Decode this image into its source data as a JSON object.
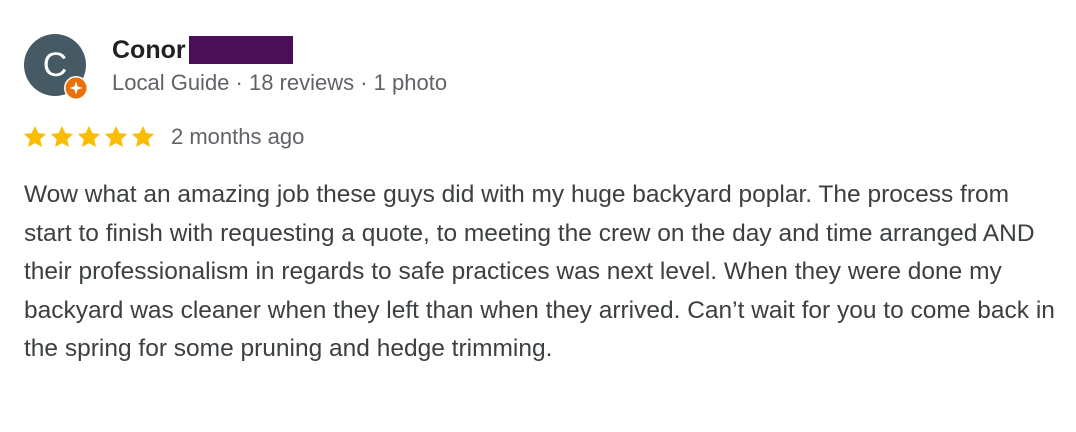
{
  "reviewer": {
    "initial": "C",
    "name": "Conor",
    "meta": "Local Guide · 18 reviews · 1 photo"
  },
  "review": {
    "rating": 5,
    "max_rating": 5,
    "time": "2 months ago",
    "text": "Wow what an amazing job these guys did with my huge backyard poplar. The process from start to finish with requesting a quote, to meeting the crew on the day and time arranged AND their professionalism in regards to safe practices was next level. When they were done my backyard was cleaner when they left than when they arrived. Can’t wait for you to come back in the spring for some pruning and hedge trimming."
  },
  "colors": {
    "avatar_bg": "#455a64",
    "local_guide_badge": "#e8710a",
    "star_filled": "#fbbc04",
    "redaction": "#4a0f57"
  },
  "icons": {
    "badge": "local-guide-badge-icon",
    "star": "star-icon"
  }
}
